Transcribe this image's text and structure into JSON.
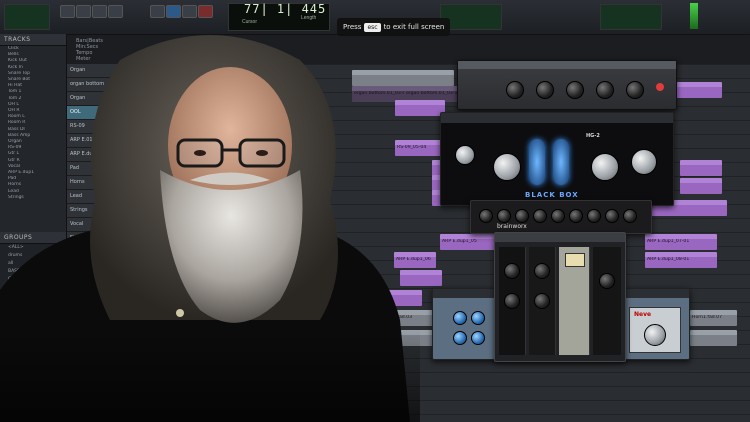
{
  "transport": {
    "counter_main": "77| 1| 445",
    "sub_labels": [
      "Cursor",
      "Length"
    ],
    "hint_prefix": "Press",
    "hint_key": "esc",
    "hint_suffix": "to exit full screen"
  },
  "panels": {
    "tracks_title": "TRACKS",
    "groups_title": "GROUPS"
  },
  "tracks_list": [
    "Click",
    "Bells",
    "Kick Out",
    "Kick In",
    "Snare Top",
    "Snare Bot",
    "Hi Hat",
    "Tom 1",
    "Tom 2",
    "OH L",
    "OH R",
    "Room L",
    "Room R",
    "Bass DI",
    "Bass Amp",
    "Organ",
    "RS-09",
    "Gtr L",
    "Gtr R",
    "Vocal",
    "ARP E.dup1",
    "Pad",
    "Horns",
    "Lead",
    "Strings"
  ],
  "groups_list": [
    "<ALL>",
    "drums",
    "all",
    "BASS",
    "GTR",
    "STR",
    "SYN",
    "KEYS",
    "VOX",
    "BASS DRUM",
    "FX"
  ],
  "ruler_labels": [
    "Bars|Beats",
    "Min:Secs",
    "Tempo",
    "Meter",
    "Markers"
  ],
  "track_headers": [
    "Organ",
    "organ bottom",
    "Organ",
    "OOL",
    "RS-09",
    "ARP E.01",
    "ARP E.dup1",
    "Pad",
    "Horns",
    "Lead",
    "Strings",
    "Vocal",
    "FX"
  ],
  "clips": [
    "organ bottom.01_03-04",
    "organ bottom.01_03-11",
    "RS-09_05-04",
    "ARP E.dup1_05",
    "ARP E.dup1_06",
    "ARP E.dup1_03-04",
    "ARP E.dup1_07-01",
    "ARP E.dup1_08-01",
    "Horn1.fad.03",
    "Horn1.fad.07"
  ],
  "plugins": {
    "blackbox_model": "HG-2",
    "blackbox_brand": "BLACK BOX",
    "brainworx_brand": "brainworx",
    "neve_brand": "Neve"
  }
}
